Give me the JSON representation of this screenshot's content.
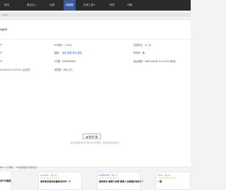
{
  "nav": {
    "items": [
      {
        "label": "首页",
        "active": false
      },
      {
        "label": "整合包",
        "active": false
      },
      {
        "label": "社群",
        "active": false
      },
      {
        "label": "我屋牆",
        "active": true
      },
      {
        "label": "实用工具",
        "active": false
      },
      {
        "label": "特性",
        "active": false
      },
      {
        "label": "词典",
        "active": false
      }
    ],
    "dropdown_arrow": "▾"
  },
  "breadcrumb": "Yugeli",
  "title": "ogeli",
  "info": {
    "row1": {
      "left_label": "户",
      "mc_label": "MC版本：",
      "mc_value": "1.15.1",
      "online_label": "在线时长：",
      "online_value": "0 / 10"
    },
    "row2": {
      "left_label": "户",
      "tags_label": "模组：",
      "tags": [
        "电站",
        "联通",
        "修高",
        "服务"
      ],
      "company_label": "所有本：",
      "company_value": "私"
    },
    "row3": {
      "left_label": "户",
      "qq_label": "QQ群：",
      "qq_value": "935032616",
      "date_label": "最后更新：",
      "date_value": "2022-04-08 11:12:19 (手动)"
    },
    "row4": {
      "time_value": "25-06-06 15:53:41 (注天前)",
      "people_label": "成员数：",
      "people_value": "56",
      "people_unit": "(小白)"
    }
  },
  "contact_button": "联系户籍",
  "hint_text": "点击获取联系方式 用户信息有限制，未经审核请勿交流！",
  "footer": {
    "links": [
      "举 1 人 已举报",
      "♥ 按照热度分享整合包"
    ]
  },
  "recommendations": [
    {
      "author": "Lemontio",
      "level": "1级玩家",
      "stars": "★★★★★★★★★★",
      "title": "调学原来居然你最等系列学一下"
    },
    {
      "author": "QQ群93588",
      "level": "3级玩家",
      "stars": "★★★★★★★★★★",
      "title": "推荐游戏 管理不用事 要是人也要理护游戏了?"
    },
    {
      "author": "Titelp",
      "level": "2级玩家",
      "stars": "★★★★★★★★★★",
      "title": "一服"
    }
  ],
  "partial_rec_title": "空行专属服"
}
